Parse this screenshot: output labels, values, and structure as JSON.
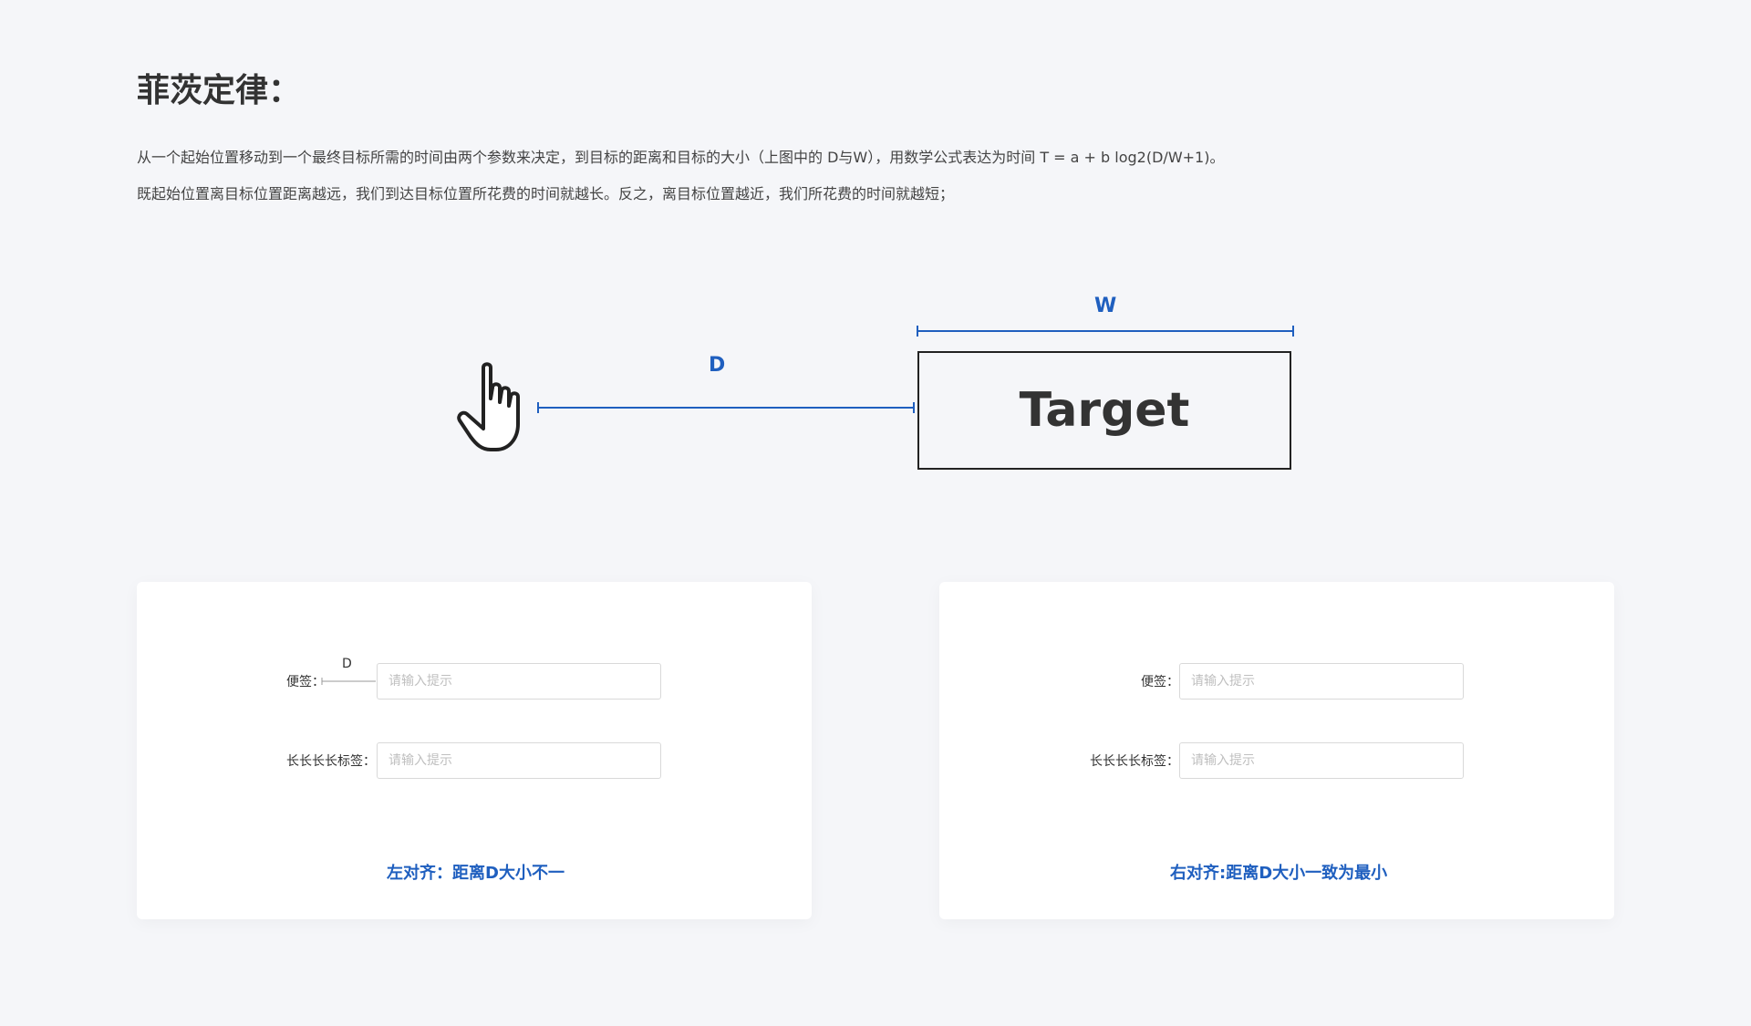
{
  "heading": "菲茨定律：",
  "paragraphs": [
    "从一个起始位置移动到一个最终目标所需的时间由两个参数来决定，到目标的距离和目标的大小（上图中的 D与W），用数学公式表达为时间 T = a + b log2(D/W+1)。",
    "既起始位置离目标位置距离越远，我们到达目标位置所花费的时间就越长。反之，离目标位置越近，我们所花费的时间就越短；"
  ],
  "diagram": {
    "target_label": "Target",
    "w_label": "W",
    "d_label": "D",
    "accent_color": "#1f5fbf",
    "cursor_icon": "hand-pointer-icon"
  },
  "left_card": {
    "d_label": "D",
    "field1_label": "便签：",
    "field1_placeholder": "请输入提示",
    "field2_label": "长长长长标签：",
    "field2_placeholder": "请输入提示",
    "caption": "左对齐：距离D大小不一"
  },
  "right_card": {
    "field1_label": "便签：",
    "field1_placeholder": "请输入提示",
    "field2_label": "长长长长标签：",
    "field2_placeholder": "请输入提示",
    "caption": "右对齐:距离D大小一致为最小"
  }
}
